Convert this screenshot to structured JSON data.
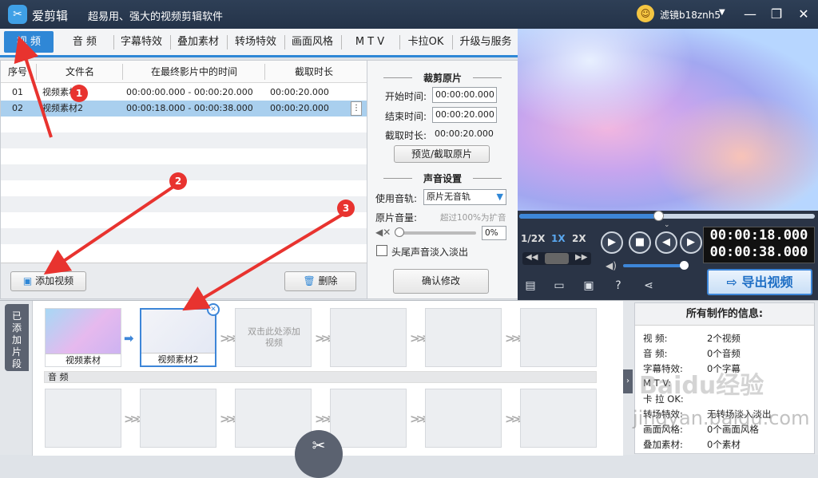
{
  "app": {
    "name": "爱剪辑",
    "slogan": "超易用、强大的视频剪辑软件",
    "user": "滤镜b18znh5"
  },
  "tabs": [
    "视  频",
    "音  频",
    "字幕特效",
    "叠加素材",
    "转场特效",
    "画面风格",
    "M T V",
    "卡拉OK",
    "升级与服务"
  ],
  "table": {
    "headers": [
      "序号",
      "文件名",
      "在最终影片中的时间",
      "截取时长"
    ],
    "rows": [
      {
        "index": "01",
        "name": "视频素材",
        "time": "00:00:00.000 - 00:00:20.000",
        "duration": "00:00:20.000"
      },
      {
        "index": "02",
        "name": "视频素材2",
        "time": "00:00:18.000 - 00:00:38.000",
        "duration": "00:00:20.000"
      }
    ],
    "row_menu": "⋮"
  },
  "buttons": {
    "add_video": "添加视频",
    "delete": "删除",
    "confirm": "确认修改",
    "preview_cut": "预览/截取原片",
    "export": "导出视频"
  },
  "crop": {
    "title": "裁剪原片",
    "start_label": "开始时间:",
    "start_value": "00:00:00.000",
    "end_label": "结束时间:",
    "end_value": "00:00:20.000",
    "duration_label": "截取时长:",
    "duration_value": "00:00:20.000"
  },
  "sound": {
    "title": "声音设置",
    "track_label": "使用音轨:",
    "track_value": "原片无音轨",
    "volume_label": "原片音量:",
    "volume_hint": "超过100%为扩音",
    "volume_value": "0%",
    "fade_label": "头尾声音淡入淡出"
  },
  "player": {
    "progress": 0.47,
    "speeds": [
      "1/2X",
      "1X",
      "2X"
    ],
    "active_speed": "1X",
    "time_current": "00:00:18.000",
    "time_total": "00:00:38.000"
  },
  "timeline": {
    "side_label": "已添加片段",
    "clips": [
      "视频素材",
      "视频素材2"
    ],
    "placeholder": "双击此处添加视频",
    "audio_label": "音  频"
  },
  "info": {
    "title": "所有制作的信息:",
    "rows": [
      {
        "k": "视    频:",
        "v": "2个视频"
      },
      {
        "k": "音    频:",
        "v": "0个音频"
      },
      {
        "k": "字幕特效:",
        "v": "0个字幕"
      },
      {
        "k": "M  T  V:",
        "v": ""
      },
      {
        "k": "卡 拉 OK:",
        "v": ""
      },
      {
        "k": "转场特效:",
        "v": "无转场淡入淡出"
      },
      {
        "k": "画面风格:",
        "v": "0个画面风格"
      },
      {
        "k": "叠加素材:",
        "v": "0个素材"
      }
    ]
  },
  "markers": [
    "1",
    "2",
    "3"
  ],
  "watermark": "Baidu经验",
  "watermark2": "jingyan.baidu.com",
  "colors": {
    "accent": "#2f87d6",
    "marker": "#e8332f",
    "titlebar": "#2e3f56"
  }
}
